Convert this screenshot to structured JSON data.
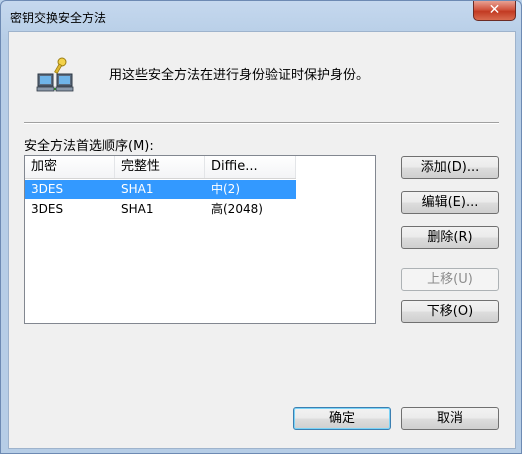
{
  "window": {
    "title": "密钥交换安全方法",
    "close_label": "✕"
  },
  "header": {
    "description": "用这些安全方法在进行身份验证时保护身份。"
  },
  "list": {
    "label": "安全方法首选顺序(M):",
    "columns": [
      "加密",
      "完整性",
      "Diffie..."
    ],
    "rows": [
      {
        "encryption": "3DES",
        "integrity": "SHA1",
        "diffie": "中(2)",
        "selected": true
      },
      {
        "encryption": "3DES",
        "integrity": "SHA1",
        "diffie": "高(2048)",
        "selected": false
      }
    ]
  },
  "buttons": {
    "add": "添加(D)...",
    "edit": "编辑(E)...",
    "remove": "删除(R)",
    "move_up": "上移(U)",
    "move_down": "下移(O)",
    "ok": "确定",
    "cancel": "取消"
  },
  "colors": {
    "selection": "#3399ff",
    "close_button": "#c23a22"
  },
  "icons": {
    "header": "network-computers-key-icon"
  }
}
